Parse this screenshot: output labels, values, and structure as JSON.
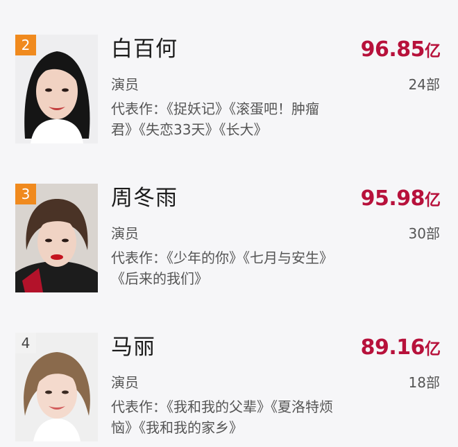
{
  "ranking": {
    "items": [
      {
        "rank": "2",
        "name": "白百何",
        "box_office_value": "96.85",
        "box_office_unit": "亿",
        "role": "演员",
        "film_count": "24部",
        "works_line1": "代表作：《捉妖记》《滚蛋吧！肿瘤",
        "works_line2": "君》《失恋33天》《长大》",
        "badge_color": "#f08a1e"
      },
      {
        "rank": "3",
        "name": "周冬雨",
        "box_office_value": "95.98",
        "box_office_unit": "亿",
        "role": "演员",
        "film_count": "30部",
        "works_line1": "代表作：《少年的你》《七月与安生》",
        "works_line2": "《后来的我们》",
        "badge_color": "#f08a1e"
      },
      {
        "rank": "4",
        "name": "马丽",
        "box_office_value": "89.16",
        "box_office_unit": "亿",
        "role": "演员",
        "film_count": "18部",
        "works_line1": "代表作：《我和我的父辈》《夏洛特烦",
        "works_line2": "恼》《我和我的家乡》",
        "badge_color": "#f2f2f2"
      }
    ]
  },
  "colors": {
    "box_office": "#b7113b",
    "badge_top3": "#f08a1e",
    "background": "#f6f6f8"
  }
}
